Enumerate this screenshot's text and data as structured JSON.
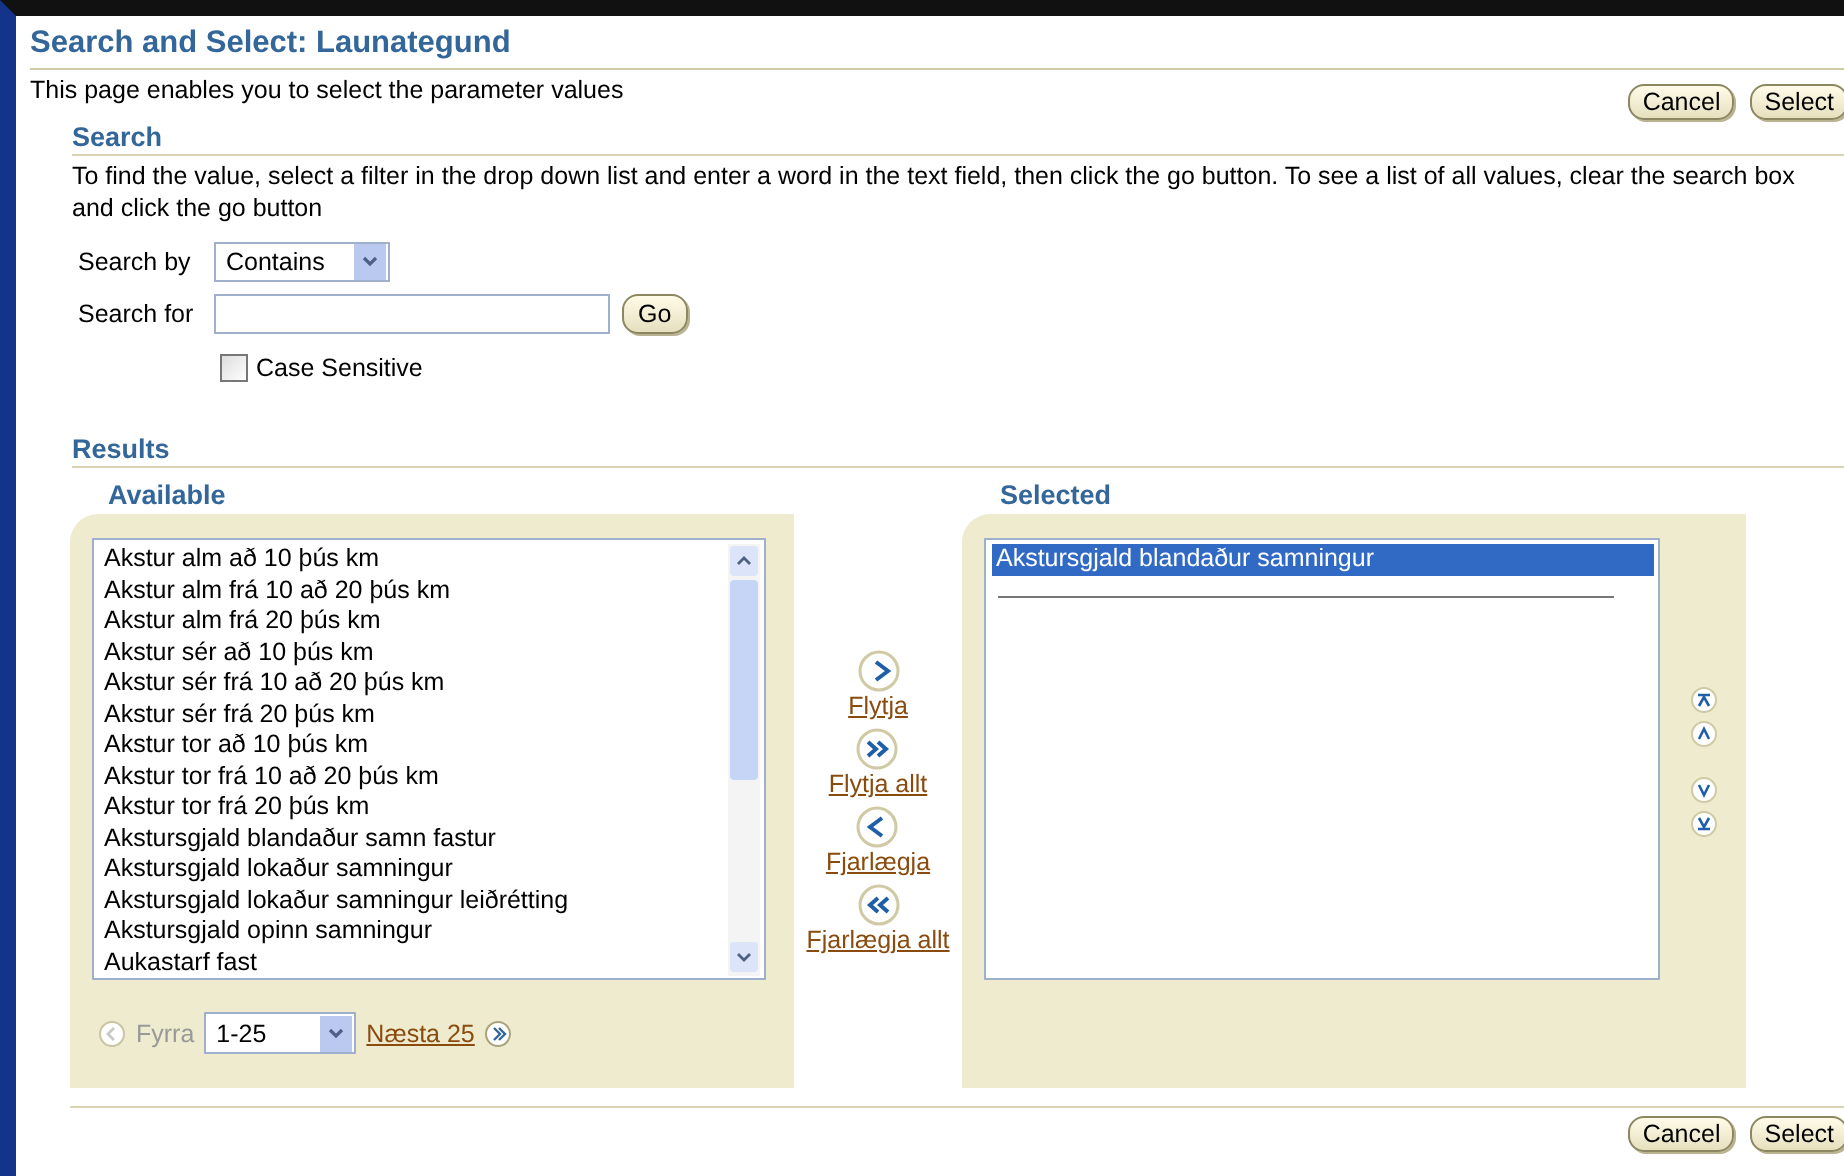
{
  "page": {
    "title": "Search and Select: Launategund",
    "description": "This page enables you to select the parameter values"
  },
  "top_buttons": [
    "Cancel",
    "Select"
  ],
  "search": {
    "heading": "Search",
    "instructions": "To find the value, select a filter in the drop down list and enter a word in the text field, then click the go button. To see a list of all values, clear the search box and click the go button",
    "search_by": {
      "label": "Search by",
      "value": "Contains"
    },
    "search_for": {
      "label": "Search for"
    },
    "go_button": "Go",
    "case_sensitive": {
      "label": "Case Sensitive",
      "checked": false
    }
  },
  "results": {
    "heading": "Results",
    "available": {
      "heading": "Available",
      "items": [
        {
          "label": "Akstur alm að 10 þús km",
          "selected": false
        },
        {
          "label": "Akstur alm frá 10 að 20 þús km",
          "selected": false
        },
        {
          "label": "Akstur alm frá 20 þús km",
          "selected": false
        },
        {
          "label": "Akstur sér að 10 þús km",
          "selected": false
        },
        {
          "label": "Akstur sér frá 10 að 20 þús km",
          "selected": false
        },
        {
          "label": "Akstur sér frá 20 þús km",
          "selected": false
        },
        {
          "label": "Akstur tor að 10 þús km",
          "selected": false
        },
        {
          "label": "Akstur tor frá 10 að 20 þús km",
          "selected": false
        },
        {
          "label": "Akstur tor frá 20 þús km",
          "selected": false
        },
        {
          "label": "Akstursgjald blandaður samn fastur",
          "selected": false
        },
        {
          "label": "Akstursgjald lokaður samningur",
          "selected": false
        },
        {
          "label": "Akstursgjald lokaður samningur leiðrétting",
          "selected": false
        },
        {
          "label": "Akstursgjald opinn samningur",
          "selected": false
        },
        {
          "label": "Aukastarf fast",
          "selected": false
        }
      ],
      "pager": {
        "previous": {
          "label": "Fyrra",
          "disabled": true
        },
        "range": "1-25",
        "next": {
          "label": "Næsta 25",
          "disabled": false
        }
      }
    },
    "move_actions": [
      {
        "kind": "move",
        "label": "Flytja"
      },
      {
        "kind": "move_all",
        "label": "Flytja allt"
      },
      {
        "kind": "remove",
        "label": "Fjarlægja"
      },
      {
        "kind": "remove_all",
        "label": "Fjarlægja allt"
      }
    ],
    "selected": {
      "heading": "Selected",
      "items": [
        {
          "label": "Akstursgjald blandaður samningur",
          "selected": true
        }
      ]
    },
    "reorder_actions": [
      {
        "kind": "top"
      },
      {
        "kind": "up"
      },
      {
        "kind": "down"
      },
      {
        "kind": "bottom"
      }
    ]
  },
  "bottom_buttons": [
    "Cancel",
    "Select"
  ]
}
